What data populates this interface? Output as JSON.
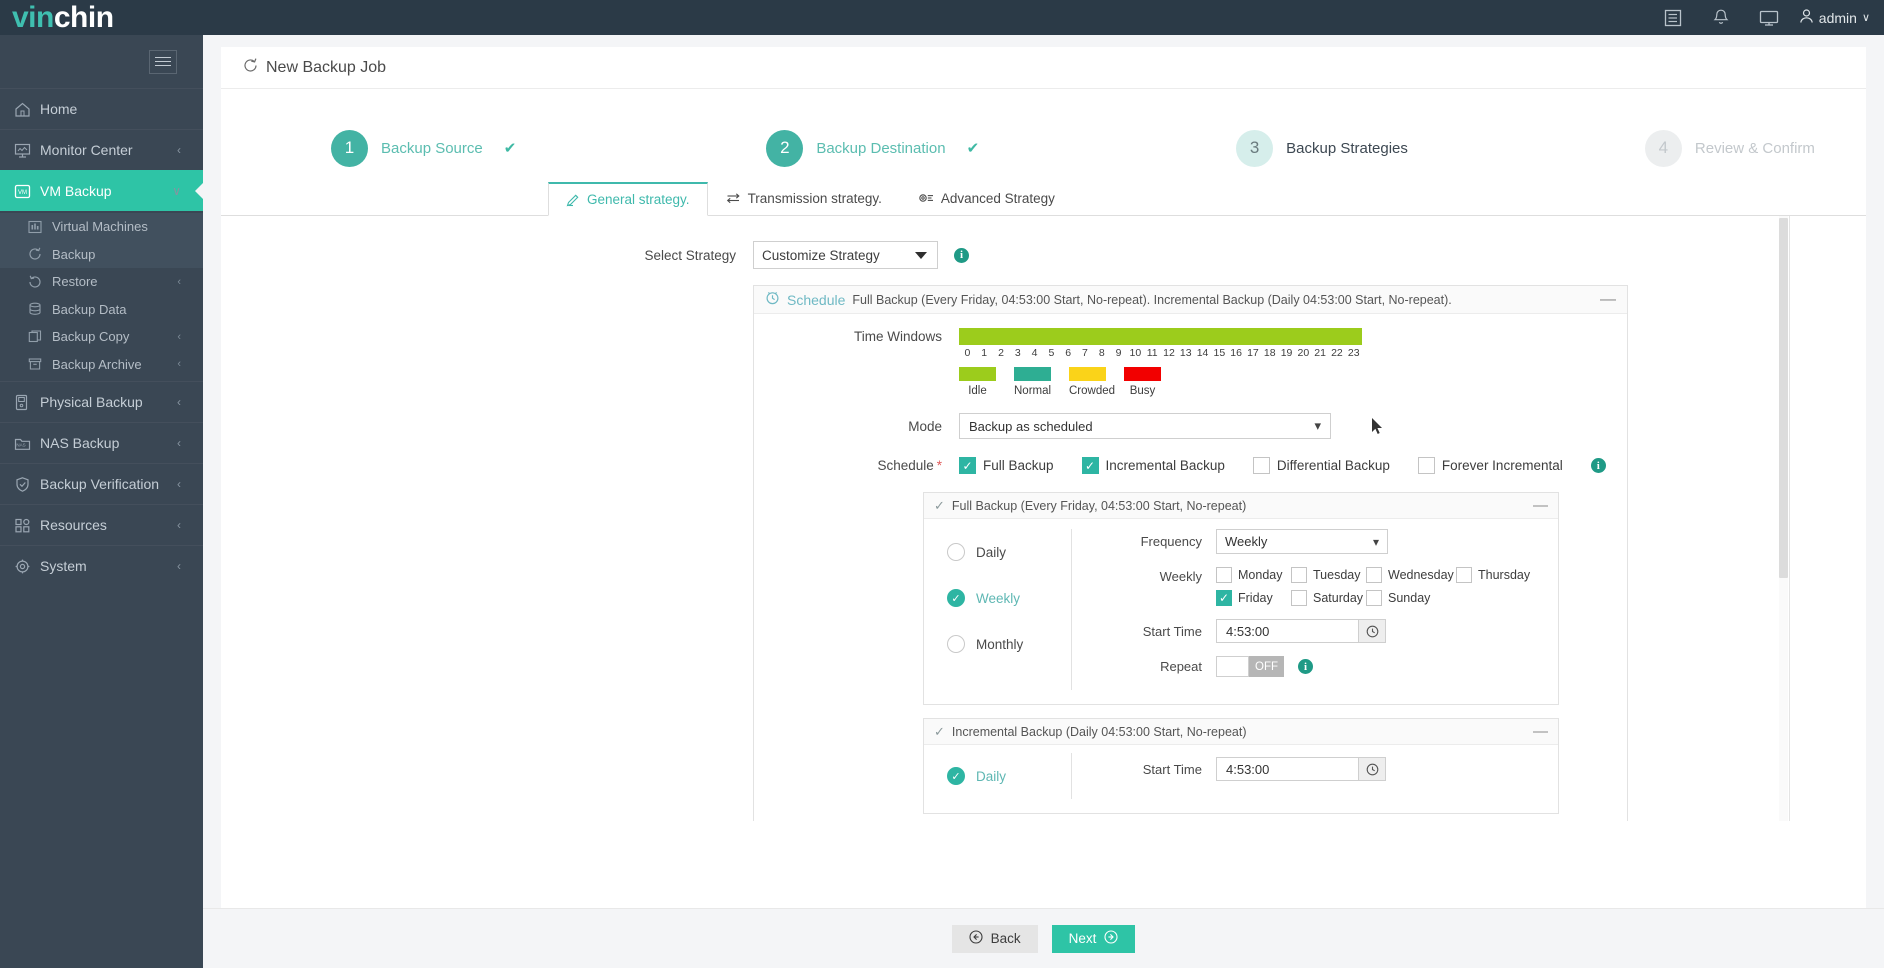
{
  "brand": {
    "part1": "vin",
    "part2": "chin"
  },
  "topbar": {
    "icons": [
      {
        "name": "list-icon",
        "glyph": "☰"
      },
      {
        "name": "bell-icon",
        "glyph": "🔔"
      },
      {
        "name": "monitor-icon",
        "glyph": "🖵"
      }
    ],
    "user": "admin",
    "user_caret": "∨"
  },
  "sidebar": {
    "items": [
      {
        "label": "Home",
        "icon": "home-icon",
        "arrow": "",
        "active": false
      },
      {
        "label": "Monitor Center",
        "icon": "monitor-center-icon",
        "arrow": "‹",
        "active": false
      },
      {
        "label": "VM Backup",
        "icon": "vm-icon",
        "arrow": "∨",
        "active": true
      }
    ],
    "subitems": [
      {
        "label": "Virtual Machines",
        "icon": "virtual-machines-icon",
        "arrow": ""
      },
      {
        "label": "Backup",
        "icon": "backup-icon",
        "arrow": ""
      },
      {
        "label": "Restore",
        "icon": "restore-icon",
        "arrow": "‹"
      },
      {
        "label": "Backup Data",
        "icon": "backup-data-icon",
        "arrow": ""
      },
      {
        "label": "Backup Copy",
        "icon": "backup-copy-icon",
        "arrow": "‹"
      },
      {
        "label": "Backup Archive",
        "icon": "backup-archive-icon",
        "arrow": "‹"
      }
    ],
    "items_bottom": [
      {
        "label": "Physical Backup",
        "icon": "physical-backup-icon",
        "arrow": "‹"
      },
      {
        "label": "NAS Backup",
        "icon": "nas-backup-icon",
        "arrow": "‹"
      },
      {
        "label": "Backup Verification",
        "icon": "backup-verification-icon",
        "arrow": "‹"
      },
      {
        "label": "Resources",
        "icon": "resources-icon",
        "arrow": "‹"
      },
      {
        "label": "System",
        "icon": "system-icon",
        "arrow": "‹"
      }
    ]
  },
  "page": {
    "title": "New Backup Job",
    "title_icon": "refresh-icon"
  },
  "stepper": {
    "steps": [
      {
        "num": "1",
        "label": "Backup Source",
        "state": "done",
        "check": "✔"
      },
      {
        "num": "2",
        "label": "Backup Destination",
        "state": "done",
        "check": "✔"
      },
      {
        "num": "3",
        "label": "Backup Strategies",
        "state": "current",
        "check": ""
      },
      {
        "num": "4",
        "label": "Review & Confirm",
        "state": "todo",
        "check": ""
      }
    ]
  },
  "tabs": [
    {
      "label": "General strategy.",
      "icon": "pencil-icon",
      "active": true
    },
    {
      "label": "Transmission strategy.",
      "icon": "transfer-icon",
      "active": false
    },
    {
      "label": "Advanced Strategy",
      "icon": "gear-list-icon",
      "active": false
    }
  ],
  "form": {
    "select_strategy_label": "Select Strategy",
    "select_strategy_value": "Customize Strategy",
    "schedule_panel": {
      "title": "Schedule",
      "subtitle": "Full Backup (Every Friday, 04:53:00 Start, No-repeat). Incremental Backup (Daily 04:53:00 Start, No-repeat).",
      "minimize": "—"
    },
    "time_windows_label": "Time Windows",
    "time_windows_hours": [
      "0",
      "1",
      "2",
      "3",
      "4",
      "5",
      "6",
      "7",
      "8",
      "9",
      "10",
      "11",
      "12",
      "13",
      "14",
      "15",
      "16",
      "17",
      "18",
      "19",
      "20",
      "21",
      "22",
      "23"
    ],
    "time_windows_legend": [
      {
        "name": "Idle",
        "color": "#9ccc1c"
      },
      {
        "name": "Normal",
        "color": "#2eae93"
      },
      {
        "name": "Crowded",
        "color": "#fad319"
      },
      {
        "name": "Busy",
        "color": "#f20000"
      }
    ],
    "time_windows_bar_color": "#9ccc1c",
    "mode_label": "Mode",
    "mode_value": "Backup as scheduled",
    "schedule_label": "Schedule",
    "schedule_required": "*",
    "schedule_checkboxes": [
      {
        "label": "Full Backup",
        "checked": true
      },
      {
        "label": "Incremental Backup",
        "checked": true
      },
      {
        "label": "Differential Backup",
        "checked": false
      },
      {
        "label": "Forever Incremental",
        "checked": false
      }
    ],
    "full_backup": {
      "header": "Full Backup (Every Friday, 04:53:00 Start, No-repeat)",
      "minimize": "—",
      "radios": [
        {
          "label": "Daily",
          "selected": false
        },
        {
          "label": "Weekly",
          "selected": true
        },
        {
          "label": "Monthly",
          "selected": false
        }
      ],
      "frequency_label": "Frequency",
      "frequency_value": "Weekly",
      "weekly_label": "Weekly",
      "days_row1": [
        {
          "label": "Monday",
          "checked": false
        },
        {
          "label": "Tuesday",
          "checked": false
        },
        {
          "label": "Wednesday",
          "checked": false
        },
        {
          "label": "Thursday",
          "checked": false
        }
      ],
      "days_row2": [
        {
          "label": "Friday",
          "checked": true
        },
        {
          "label": "Saturday",
          "checked": false
        },
        {
          "label": "Sunday",
          "checked": false
        }
      ],
      "start_time_label": "Start Time",
      "start_time_value": "4:53:00",
      "repeat_label": "Repeat",
      "repeat_state": "OFF"
    },
    "incremental_backup": {
      "header": "Incremental Backup (Daily 04:53:00 Start, No-repeat)",
      "minimize": "—",
      "radios": [
        {
          "label": "Daily",
          "selected": true
        }
      ],
      "start_time_label": "Start Time",
      "start_time_value": "4:53:00"
    }
  },
  "footer": {
    "back_label": "Back",
    "next_label": "Next"
  },
  "colors": {
    "accent": "#2ec4a6",
    "sidebar": "#3a4754",
    "topbar": "#2b3a47"
  }
}
